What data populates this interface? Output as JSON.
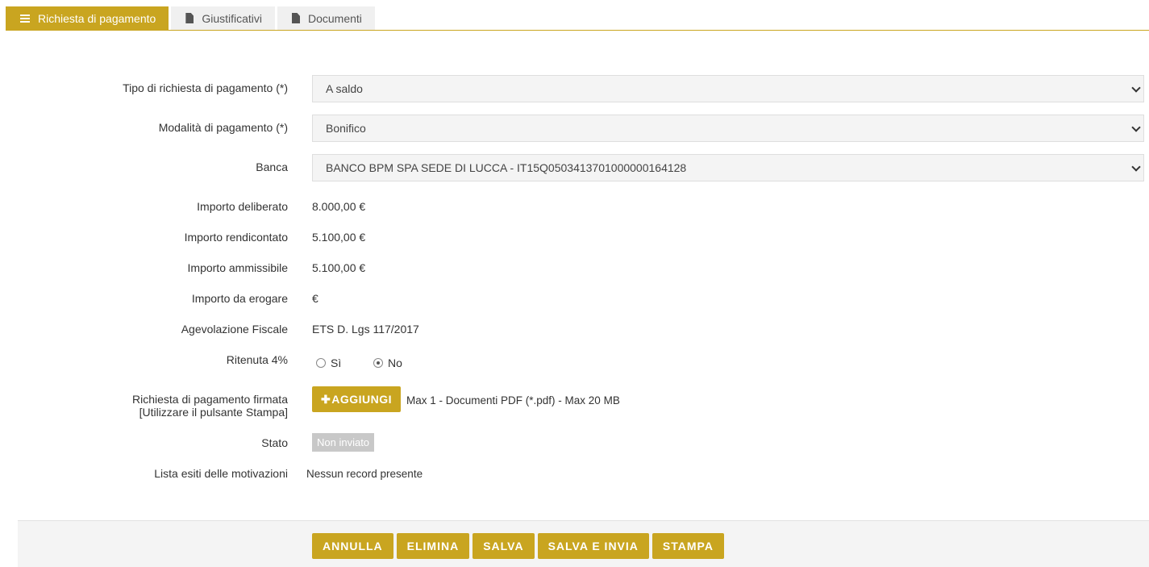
{
  "tabs": [
    {
      "label": "Richiesta di pagamento",
      "icon": "menu-icon",
      "active": true
    },
    {
      "label": "Giustificativi",
      "icon": "document-icon",
      "active": false
    },
    {
      "label": "Documenti",
      "icon": "document-icon",
      "active": false
    }
  ],
  "form": {
    "tipo_label": "Tipo di richiesta di pagamento (*)",
    "tipo_value": "A saldo",
    "modalita_label": "Modalità di pagamento (*)",
    "modalita_value": "Bonifico",
    "banca_label": "Banca",
    "banca_value": "BANCO BPM SPA SEDE DI LUCCA - IT15Q0503413701000000164128",
    "deliberato_label": "Importo deliberato",
    "deliberato_value": "8.000,00 €",
    "rendicontato_label": "Importo rendicontato",
    "rendicontato_value": "5.100,00 €",
    "ammissibile_label": "Importo ammissibile",
    "ammissibile_value": "5.100,00 €",
    "erogare_label": "Importo da erogare",
    "erogare_value": "€",
    "agevolazione_label": "Agevolazione Fiscale",
    "agevolazione_value": "ETS D. Lgs 117/2017",
    "ritenuta_label": "Ritenuta 4%",
    "ritenuta_options": [
      {
        "label": "Sì",
        "checked": false
      },
      {
        "label": "No",
        "checked": true
      }
    ],
    "firmata_label_line1": "Richiesta di pagamento firmata",
    "firmata_label_line2": "[Utilizzare il pulsante Stampa]",
    "aggiungi_label": "AGGIUNGI",
    "upload_hint": "Max 1 - Documenti PDF (*.pdf) - Max 20 MB",
    "stato_label": "Stato",
    "stato_value": "Non inviato",
    "esiti_label": "Lista esiti delle motivazioni",
    "esiti_value": "Nessun record presente"
  },
  "footer": {
    "annulla": "ANNULLA",
    "elimina": "ELIMINA",
    "salva": "SALVA",
    "salva_invia": "SALVA E INVIA",
    "stampa": "STAMPA"
  },
  "colors": {
    "accent": "#c9a520",
    "badge_gray": "#c8c8c8"
  }
}
